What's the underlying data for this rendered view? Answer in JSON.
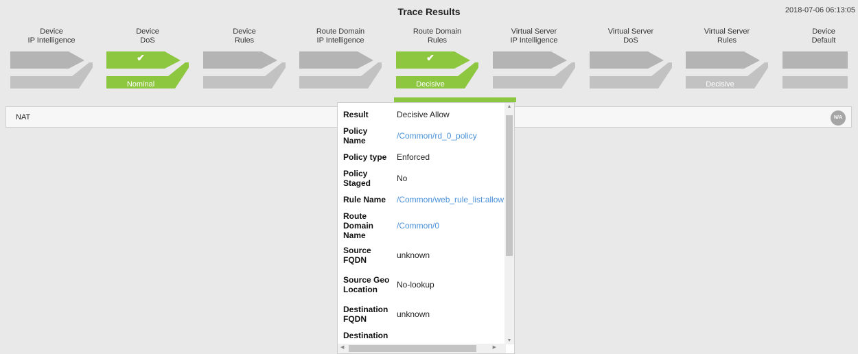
{
  "header": {
    "title": "Trace Results",
    "timestamp": "2018-07-06 06:13:05"
  },
  "colors": {
    "active": "#8dc63f",
    "inactive": "#b4b4b4",
    "inactive_lower": "#c2c2c2"
  },
  "stages": [
    {
      "line1": "Device",
      "line2": "IP Intelligence",
      "active": false,
      "checked": false,
      "status": ""
    },
    {
      "line1": "Device",
      "line2": "DoS",
      "active": true,
      "checked": true,
      "status": "Nominal"
    },
    {
      "line1": "Device",
      "line2": "Rules",
      "active": false,
      "checked": false,
      "status": ""
    },
    {
      "line1": "Route Domain",
      "line2": "IP Intelligence",
      "active": false,
      "checked": false,
      "status": ""
    },
    {
      "line1": "Route Domain",
      "line2": "Rules",
      "active": true,
      "checked": true,
      "status": "Decisive"
    },
    {
      "line1": "Virtual Server",
      "line2": "IP Intelligence",
      "active": false,
      "checked": false,
      "status": ""
    },
    {
      "line1": "Virtual Server",
      "line2": "DoS",
      "active": false,
      "checked": false,
      "status": ""
    },
    {
      "line1": "Virtual Server",
      "line2": "Rules",
      "active": false,
      "checked": false,
      "status": "Decisive"
    },
    {
      "line1": "Device",
      "line2": "Default",
      "active": false,
      "checked": false,
      "status": ""
    }
  ],
  "check_glyph": "✔",
  "nat": {
    "label": "NAT",
    "badge": "N/A"
  },
  "details": [
    {
      "key": "Result",
      "value": "Decisive Allow",
      "link": false
    },
    {
      "key": "Policy Name",
      "value": "/Common/rd_0_policy",
      "link": true
    },
    {
      "key": "Policy type",
      "value": "Enforced",
      "link": false
    },
    {
      "key": "Policy Staged",
      "value": "No",
      "link": false
    },
    {
      "key": "Rule Name",
      "value": "/Common/web_rule_list:allow",
      "link": true
    },
    {
      "key": "Route Domain Name",
      "value": "/Common/0",
      "link": true
    },
    {
      "key": "Source FQDN",
      "value": "unknown",
      "link": false
    },
    {
      "key": "Source Geo Location",
      "value": "No-lookup",
      "link": false
    },
    {
      "key": "Destination FQDN",
      "value": "unknown",
      "link": false
    },
    {
      "key": "Destination",
      "value": "",
      "link": false
    }
  ],
  "scroll_icons": {
    "up": "▲",
    "down": "▼",
    "left": "◀",
    "right": "▶"
  }
}
